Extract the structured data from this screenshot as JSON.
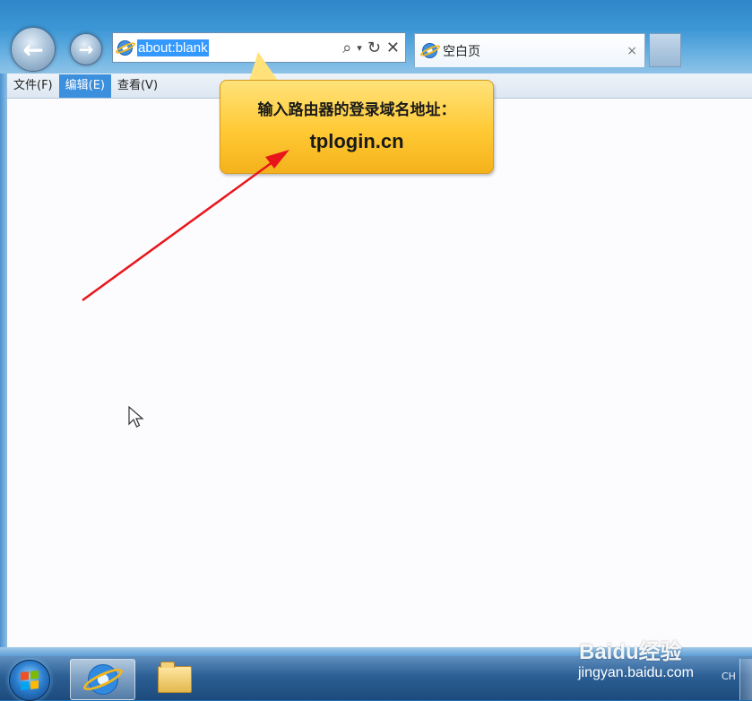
{
  "browser": {
    "address": "about:blank",
    "tab_title": "空白页",
    "tab_close": "×"
  },
  "menu": {
    "items": [
      "文件(F)",
      "编辑(E)",
      "查看(V)"
    ],
    "active_index": 1
  },
  "callout": {
    "line1": "输入路由器的登录域名地址：",
    "line2": "tplogin.cn",
    "color": "#FFC934"
  },
  "arrow_color": "#E8161B",
  "watermark": {
    "brand": "Baidu经验",
    "url": "jingyan.baidu.com"
  },
  "tray": {
    "lang": "CH"
  },
  "icons": [
    "back-icon",
    "forward-icon",
    "ie-icon",
    "search-icon",
    "dropdown-icon",
    "refresh-icon",
    "stop-icon",
    "close-icon",
    "start-icon",
    "folder-icon"
  ]
}
